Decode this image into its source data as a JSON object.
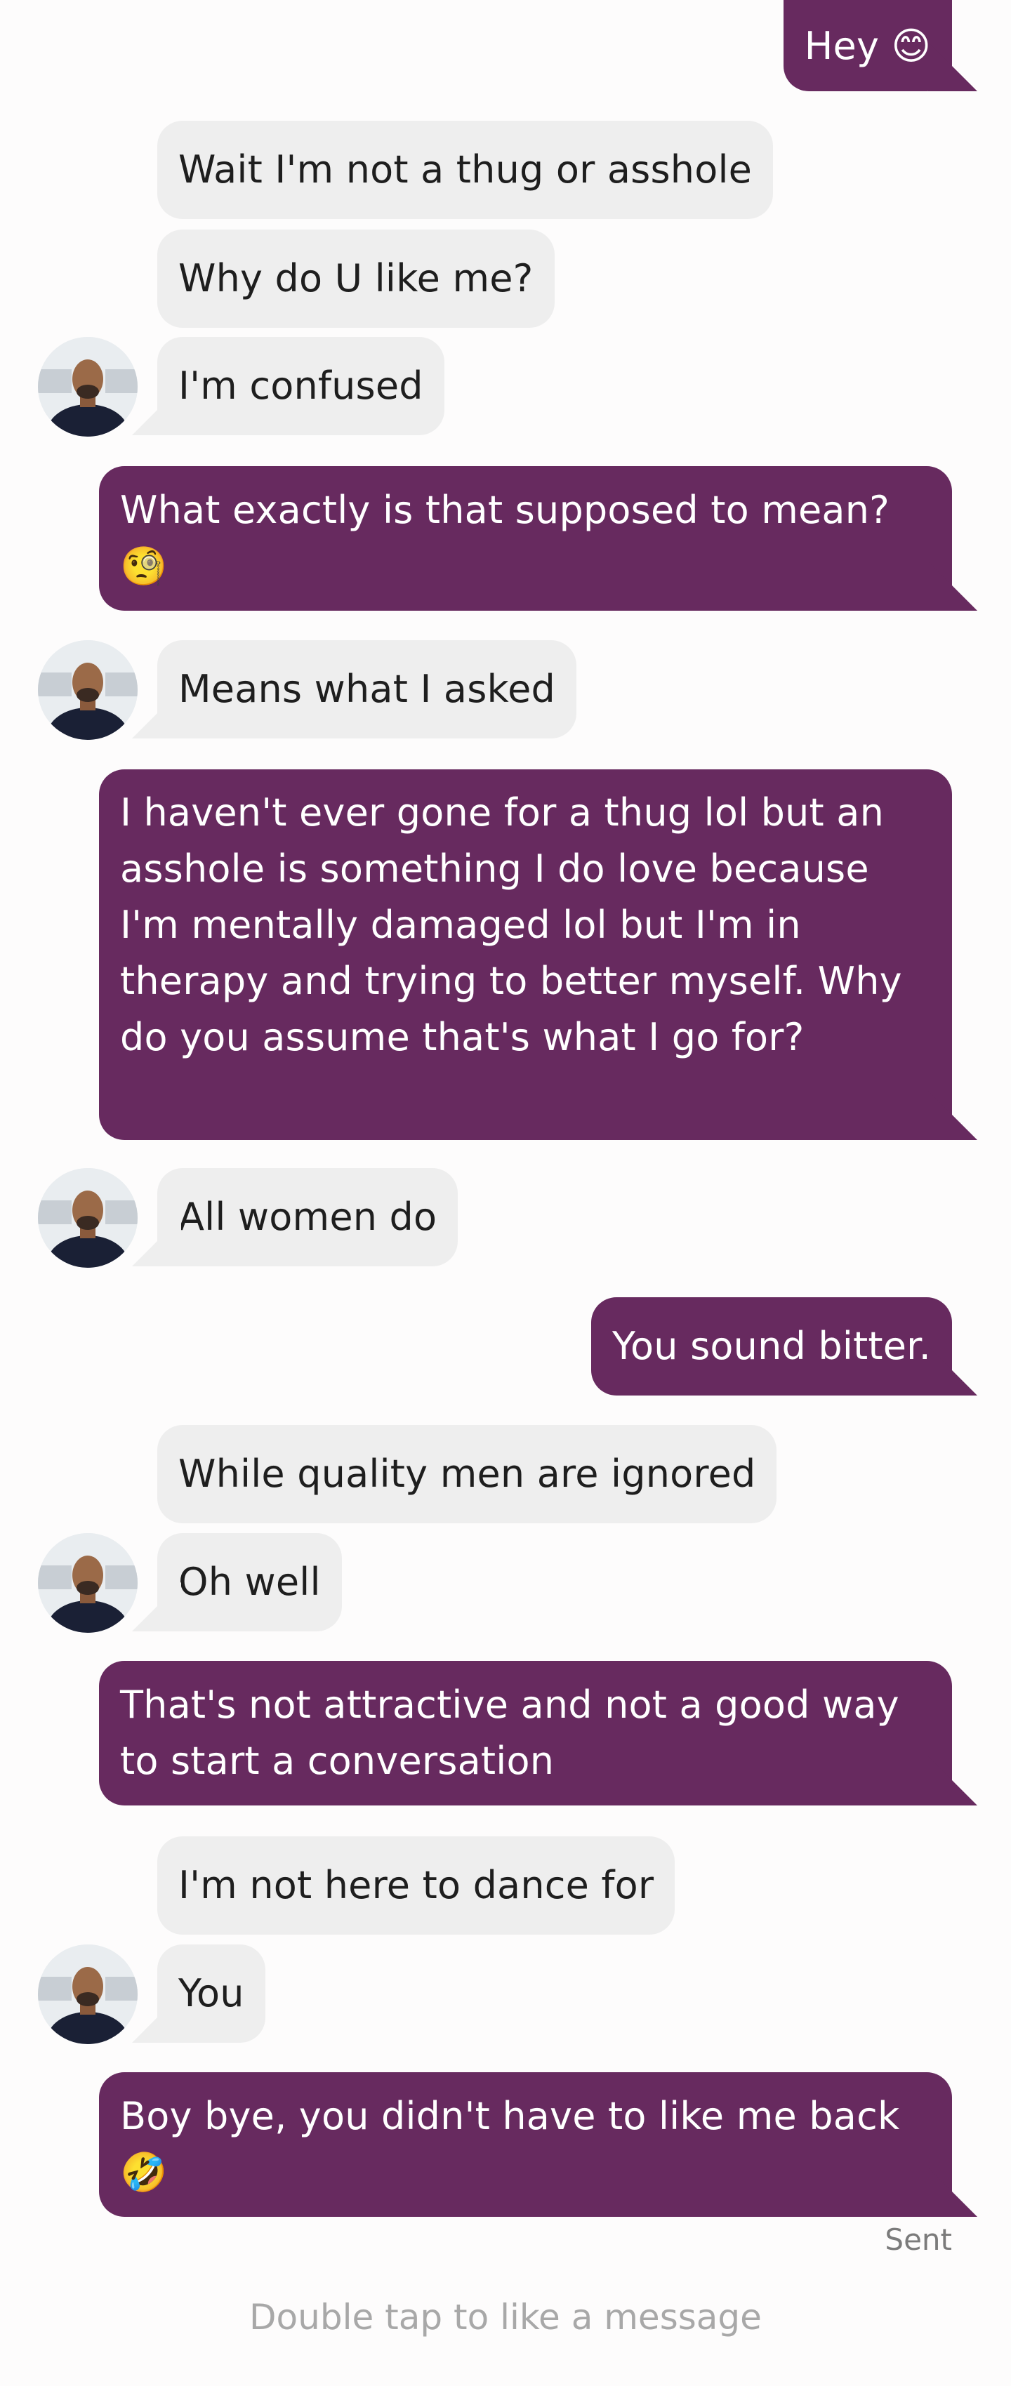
{
  "colors": {
    "background": "#fdfcfc",
    "incoming_bubble": "#eeeeee",
    "outgoing_bubble": "#672a5f",
    "outgoing_text": "#ffffff",
    "incoming_text": "#1e1e1e",
    "status_text": "#7b7b7b",
    "hint_text": "#a8a8a8"
  },
  "messages": [
    {
      "direction": "outgoing",
      "text": "Hey 😊"
    },
    {
      "direction": "incoming",
      "text": "Wait I'm not a thug or asshole"
    },
    {
      "direction": "incoming",
      "text": "Why do U like me?"
    },
    {
      "direction": "incoming",
      "text": "I'm confused"
    },
    {
      "direction": "outgoing",
      "text": "What exactly is that supposed to mean? 🧐"
    },
    {
      "direction": "incoming",
      "text": "Means what I asked"
    },
    {
      "direction": "outgoing",
      "text": "I haven't ever gone for a thug lol but an asshole is something I do love because I'm mentally damaged lol but I'm in therapy and trying to better myself. Why do you assume that's what I go for?"
    },
    {
      "direction": "incoming",
      "text": "All women do"
    },
    {
      "direction": "outgoing",
      "text": "You sound bitter."
    },
    {
      "direction": "incoming",
      "text": "While quality men are ignored"
    },
    {
      "direction": "incoming",
      "text": "Oh well"
    },
    {
      "direction": "outgoing",
      "text": "That's not attractive and not a good way to start a conversation"
    },
    {
      "direction": "incoming",
      "text": "I'm not here to dance for"
    },
    {
      "direction": "incoming",
      "text": "You"
    },
    {
      "direction": "outgoing",
      "text": "Boy bye, you didn't have to like me back 🤣"
    }
  ],
  "status": "Sent",
  "hint": "Double tap to like a message",
  "avatar_icon": "profile-photo-avatar"
}
